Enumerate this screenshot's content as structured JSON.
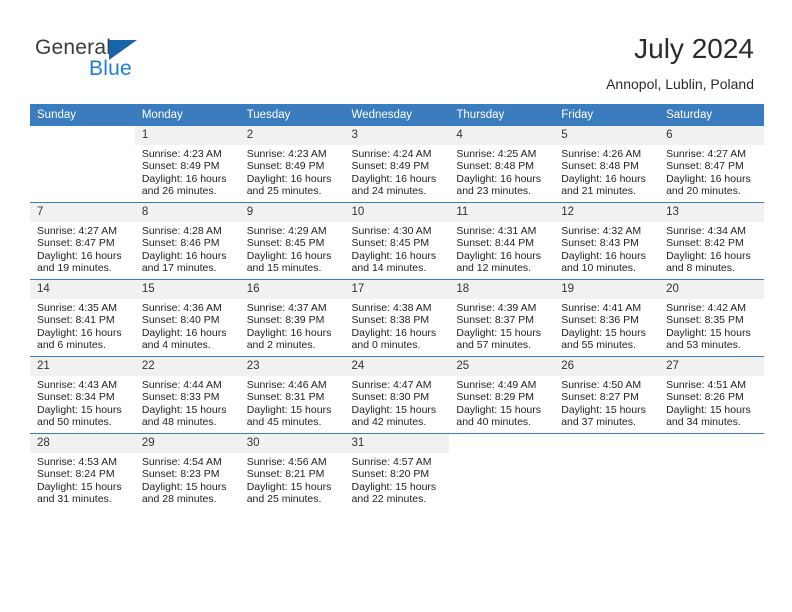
{
  "brand": {
    "name_top": "General",
    "name_bottom": "Blue",
    "triangle_color": "#1565a8",
    "blue_color": "#1a7fd4"
  },
  "header": {
    "title": "July 2024",
    "location": "Annopol, Lublin, Poland"
  },
  "theme": {
    "header_blue": "#3a7cbe",
    "daynum_gray": "#f1f1f1",
    "text": "#222222"
  },
  "weekdays": [
    "Sunday",
    "Monday",
    "Tuesday",
    "Wednesday",
    "Thursday",
    "Friday",
    "Saturday"
  ],
  "labels": {
    "sunrise_prefix": "Sunrise: ",
    "sunset_prefix": "Sunset: ",
    "daylight_prefix": "Daylight: "
  },
  "weeks": [
    [
      {
        "day": "",
        "sunrise": "",
        "sunset": "",
        "daylight": ""
      },
      {
        "day": "1",
        "sunrise": "Sunrise: 4:23 AM",
        "sunset": "Sunset: 8:49 PM",
        "daylight": "Daylight: 16 hours and 26 minutes."
      },
      {
        "day": "2",
        "sunrise": "Sunrise: 4:23 AM",
        "sunset": "Sunset: 8:49 PM",
        "daylight": "Daylight: 16 hours and 25 minutes."
      },
      {
        "day": "3",
        "sunrise": "Sunrise: 4:24 AM",
        "sunset": "Sunset: 8:49 PM",
        "daylight": "Daylight: 16 hours and 24 minutes."
      },
      {
        "day": "4",
        "sunrise": "Sunrise: 4:25 AM",
        "sunset": "Sunset: 8:48 PM",
        "daylight": "Daylight: 16 hours and 23 minutes."
      },
      {
        "day": "5",
        "sunrise": "Sunrise: 4:26 AM",
        "sunset": "Sunset: 8:48 PM",
        "daylight": "Daylight: 16 hours and 21 minutes."
      },
      {
        "day": "6",
        "sunrise": "Sunrise: 4:27 AM",
        "sunset": "Sunset: 8:47 PM",
        "daylight": "Daylight: 16 hours and 20 minutes."
      }
    ],
    [
      {
        "day": "7",
        "sunrise": "Sunrise: 4:27 AM",
        "sunset": "Sunset: 8:47 PM",
        "daylight": "Daylight: 16 hours and 19 minutes."
      },
      {
        "day": "8",
        "sunrise": "Sunrise: 4:28 AM",
        "sunset": "Sunset: 8:46 PM",
        "daylight": "Daylight: 16 hours and 17 minutes."
      },
      {
        "day": "9",
        "sunrise": "Sunrise: 4:29 AM",
        "sunset": "Sunset: 8:45 PM",
        "daylight": "Daylight: 16 hours and 15 minutes."
      },
      {
        "day": "10",
        "sunrise": "Sunrise: 4:30 AM",
        "sunset": "Sunset: 8:45 PM",
        "daylight": "Daylight: 16 hours and 14 minutes."
      },
      {
        "day": "11",
        "sunrise": "Sunrise: 4:31 AM",
        "sunset": "Sunset: 8:44 PM",
        "daylight": "Daylight: 16 hours and 12 minutes."
      },
      {
        "day": "12",
        "sunrise": "Sunrise: 4:32 AM",
        "sunset": "Sunset: 8:43 PM",
        "daylight": "Daylight: 16 hours and 10 minutes."
      },
      {
        "day": "13",
        "sunrise": "Sunrise: 4:34 AM",
        "sunset": "Sunset: 8:42 PM",
        "daylight": "Daylight: 16 hours and 8 minutes."
      }
    ],
    [
      {
        "day": "14",
        "sunrise": "Sunrise: 4:35 AM",
        "sunset": "Sunset: 8:41 PM",
        "daylight": "Daylight: 16 hours and 6 minutes."
      },
      {
        "day": "15",
        "sunrise": "Sunrise: 4:36 AM",
        "sunset": "Sunset: 8:40 PM",
        "daylight": "Daylight: 16 hours and 4 minutes."
      },
      {
        "day": "16",
        "sunrise": "Sunrise: 4:37 AM",
        "sunset": "Sunset: 8:39 PM",
        "daylight": "Daylight: 16 hours and 2 minutes."
      },
      {
        "day": "17",
        "sunrise": "Sunrise: 4:38 AM",
        "sunset": "Sunset: 8:38 PM",
        "daylight": "Daylight: 16 hours and 0 minutes."
      },
      {
        "day": "18",
        "sunrise": "Sunrise: 4:39 AM",
        "sunset": "Sunset: 8:37 PM",
        "daylight": "Daylight: 15 hours and 57 minutes."
      },
      {
        "day": "19",
        "sunrise": "Sunrise: 4:41 AM",
        "sunset": "Sunset: 8:36 PM",
        "daylight": "Daylight: 15 hours and 55 minutes."
      },
      {
        "day": "20",
        "sunrise": "Sunrise: 4:42 AM",
        "sunset": "Sunset: 8:35 PM",
        "daylight": "Daylight: 15 hours and 53 minutes."
      }
    ],
    [
      {
        "day": "21",
        "sunrise": "Sunrise: 4:43 AM",
        "sunset": "Sunset: 8:34 PM",
        "daylight": "Daylight: 15 hours and 50 minutes."
      },
      {
        "day": "22",
        "sunrise": "Sunrise: 4:44 AM",
        "sunset": "Sunset: 8:33 PM",
        "daylight": "Daylight: 15 hours and 48 minutes."
      },
      {
        "day": "23",
        "sunrise": "Sunrise: 4:46 AM",
        "sunset": "Sunset: 8:31 PM",
        "daylight": "Daylight: 15 hours and 45 minutes."
      },
      {
        "day": "24",
        "sunrise": "Sunrise: 4:47 AM",
        "sunset": "Sunset: 8:30 PM",
        "daylight": "Daylight: 15 hours and 42 minutes."
      },
      {
        "day": "25",
        "sunrise": "Sunrise: 4:49 AM",
        "sunset": "Sunset: 8:29 PM",
        "daylight": "Daylight: 15 hours and 40 minutes."
      },
      {
        "day": "26",
        "sunrise": "Sunrise: 4:50 AM",
        "sunset": "Sunset: 8:27 PM",
        "daylight": "Daylight: 15 hours and 37 minutes."
      },
      {
        "day": "27",
        "sunrise": "Sunrise: 4:51 AM",
        "sunset": "Sunset: 8:26 PM",
        "daylight": "Daylight: 15 hours and 34 minutes."
      }
    ],
    [
      {
        "day": "28",
        "sunrise": "Sunrise: 4:53 AM",
        "sunset": "Sunset: 8:24 PM",
        "daylight": "Daylight: 15 hours and 31 minutes."
      },
      {
        "day": "29",
        "sunrise": "Sunrise: 4:54 AM",
        "sunset": "Sunset: 8:23 PM",
        "daylight": "Daylight: 15 hours and 28 minutes."
      },
      {
        "day": "30",
        "sunrise": "Sunrise: 4:56 AM",
        "sunset": "Sunset: 8:21 PM",
        "daylight": "Daylight: 15 hours and 25 minutes."
      },
      {
        "day": "31",
        "sunrise": "Sunrise: 4:57 AM",
        "sunset": "Sunset: 8:20 PM",
        "daylight": "Daylight: 15 hours and 22 minutes."
      },
      {
        "day": "",
        "sunrise": "",
        "sunset": "",
        "daylight": ""
      },
      {
        "day": "",
        "sunrise": "",
        "sunset": "",
        "daylight": ""
      },
      {
        "day": "",
        "sunrise": "",
        "sunset": "",
        "daylight": ""
      }
    ]
  ]
}
